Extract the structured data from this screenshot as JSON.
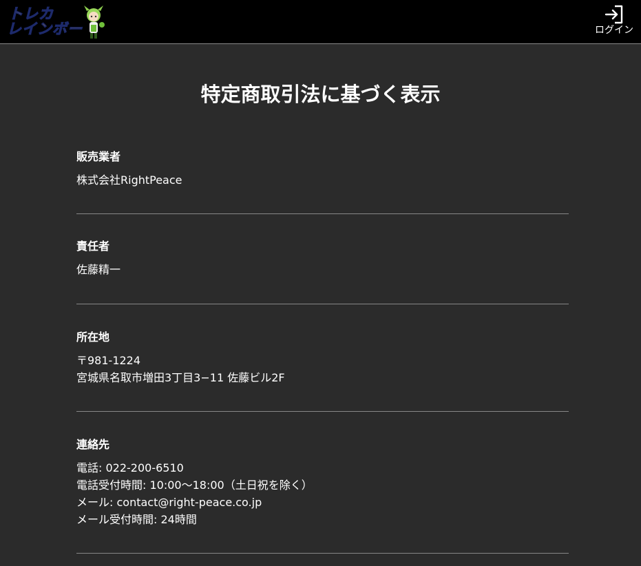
{
  "header": {
    "logo_line1": "トレカ",
    "logo_line2": "レインボー",
    "login_label": "ログイン",
    "colors": {
      "background": "#000000",
      "logo_yellow": "#ffd23a",
      "logo_outline": "#1d2a6b"
    }
  },
  "page": {
    "title": "特定商取引法に基づく表示",
    "background": "#2b2b2b"
  },
  "sections": [
    {
      "title": "販売業者",
      "lines": [
        "株式会社RightPeace"
      ]
    },
    {
      "title": "責任者",
      "lines": [
        "佐藤精一"
      ]
    },
    {
      "title": "所在地",
      "lines": [
        "〒981-1224",
        "宮城県名取市増田3丁目3−11 佐藤ビル2F"
      ]
    },
    {
      "title": "連絡先",
      "lines": [
        "電話: 022-200-6510",
        "電話受付時間: 10:00〜18:00（土日祝を除く）",
        "メール: contact@right-peace.co.jp",
        "メール受付時間: 24時間"
      ]
    }
  ]
}
